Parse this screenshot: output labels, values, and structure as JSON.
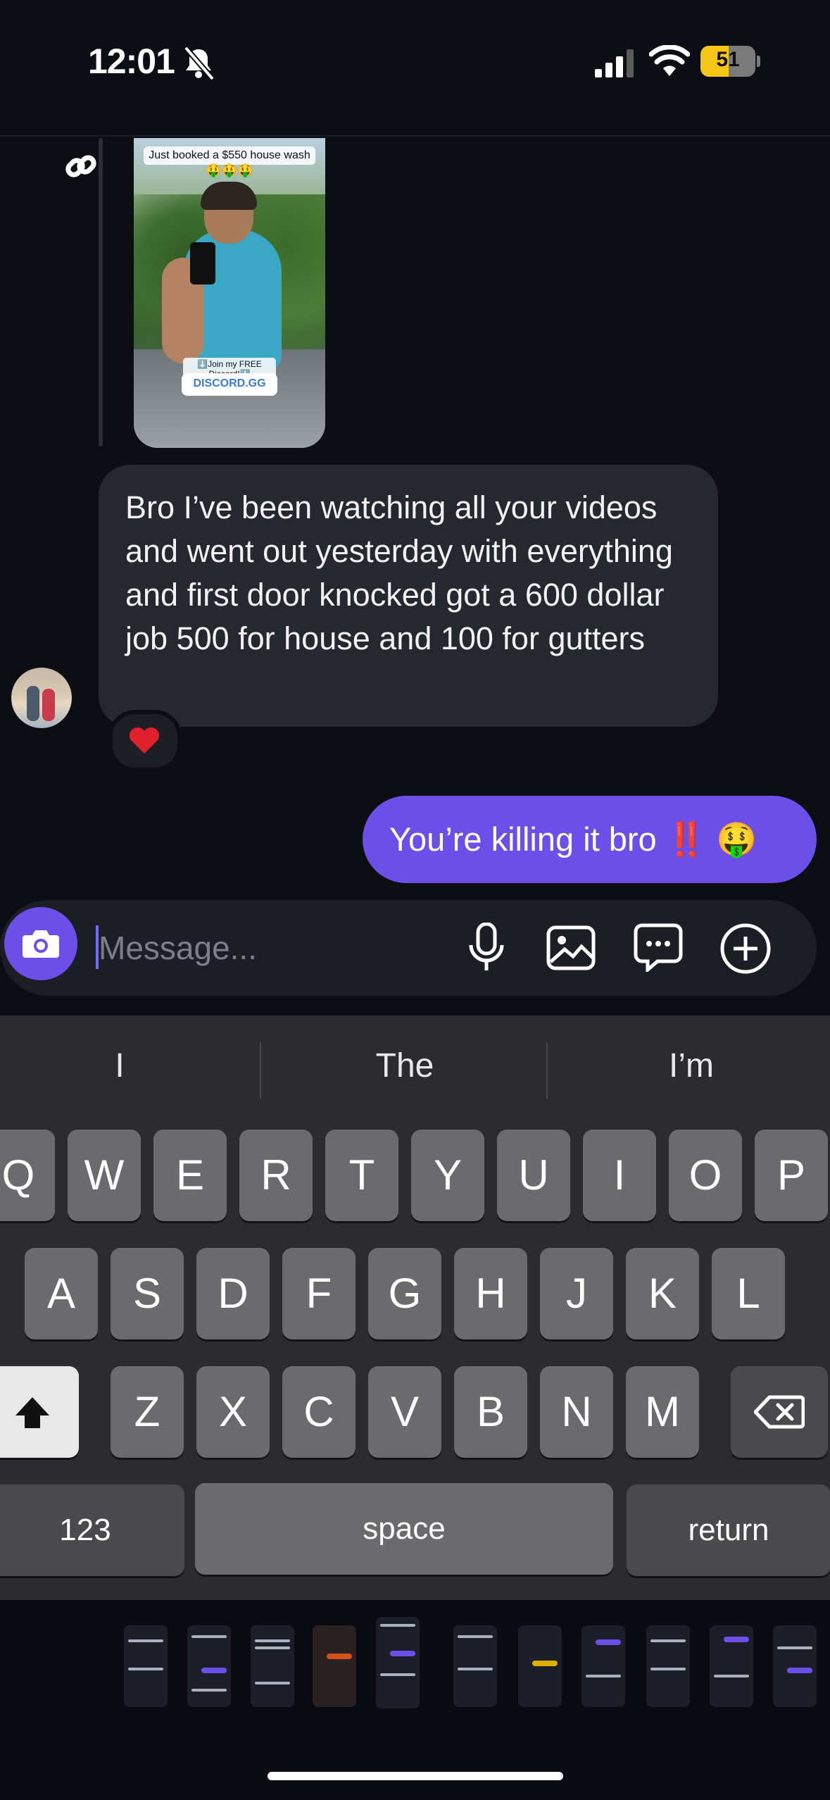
{
  "status_bar": {
    "time": "12:01",
    "battery": "51",
    "battery_level": 0.51,
    "icons": [
      "bell-slash-icon",
      "signal-icon",
      "wifi-icon",
      "battery-icon"
    ]
  },
  "shared_media": {
    "caption": "Just booked a $550 house wash",
    "emojis": "🤑🤑🤑",
    "join_text": "⬇️Join my FREE Discord!⬇️",
    "link_text": "DISCORD.GG"
  },
  "messages": {
    "received": "Bro I’ve been watching all your videos and went out yesterday with everything and first door knocked got a 600 dollar job 500 for house and 100 for gutters",
    "received_reaction": "❤️",
    "sent": "You’re killing it bro ‼️ 🤑"
  },
  "composer": {
    "placeholder": "Message..."
  },
  "keyboard": {
    "suggestions": [
      "I",
      "The",
      "I’m"
    ],
    "row1": [
      "Q",
      "W",
      "E",
      "R",
      "T",
      "Y",
      "U",
      "I",
      "O",
      "P"
    ],
    "row2": [
      "A",
      "S",
      "D",
      "F",
      "G",
      "H",
      "J",
      "K",
      "L"
    ],
    "row3": [
      "Z",
      "X",
      "C",
      "V",
      "B",
      "N",
      "M"
    ],
    "numbers_label": "123",
    "space_label": "space",
    "return_label": "return"
  },
  "colors": {
    "accent": "#6b4fe8",
    "background": "#0c0e14",
    "received_bubble": "#26282f"
  }
}
